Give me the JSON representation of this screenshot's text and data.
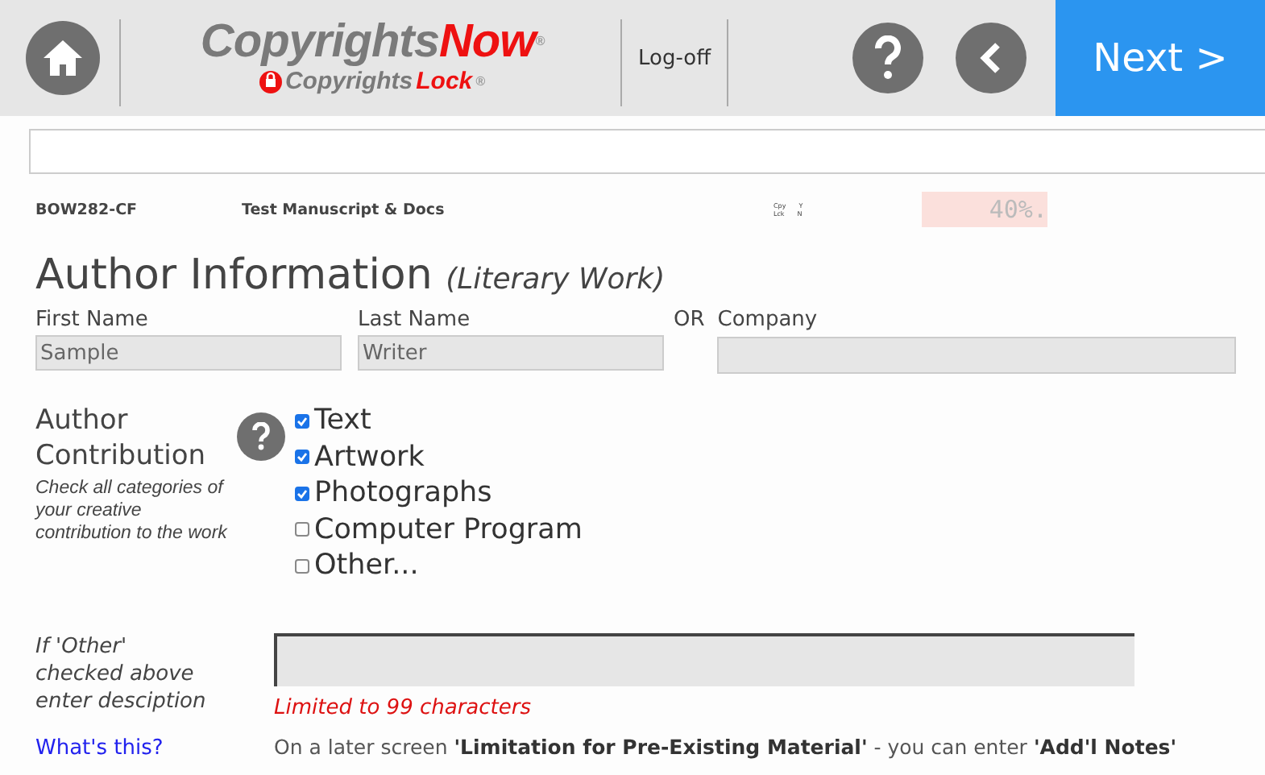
{
  "header": {
    "logo": {
      "main": "Copyrights",
      "accent": "Now",
      "mark": "®",
      "sub_main": "Copyrights",
      "sub_accent": "Lock",
      "sub_mark": "®"
    },
    "logoff": "Log-off",
    "next": "Next >"
  },
  "info": {
    "code": "BOW282-CF",
    "title": "Test Manuscript & Docs",
    "flags": [
      {
        "label": "Cpy",
        "value": "Y"
      },
      {
        "label": "Lck",
        "value": "N"
      }
    ],
    "progress": "40%."
  },
  "section": {
    "title": "Author Information",
    "subtitle": "(Literary Work)"
  },
  "name_fields": {
    "first_label": "First Name",
    "first_value": "Sample",
    "last_label": "Last Name",
    "last_value": "Writer",
    "or": "OR",
    "company_label": "Company"
  },
  "contribution": {
    "title_line1": "Author",
    "title_line2": "Contribution",
    "hint": "Check all categories of your creative contribution to the work",
    "options": [
      {
        "label": "Text",
        "checked": true
      },
      {
        "label": "Artwork",
        "checked": true
      },
      {
        "label": "Photographs",
        "checked": true
      },
      {
        "label": "Computer Program",
        "checked": false
      },
      {
        "label": "Other...",
        "checked": false
      }
    ]
  },
  "other": {
    "label": "If 'Other' checked above enter desciption",
    "link": "What's this?",
    "limit": "Limited to 99 characters",
    "note": "On a later screen **'Limitation for Pre-Existing Material'** - you can enter **'Add'l Notes'**"
  }
}
